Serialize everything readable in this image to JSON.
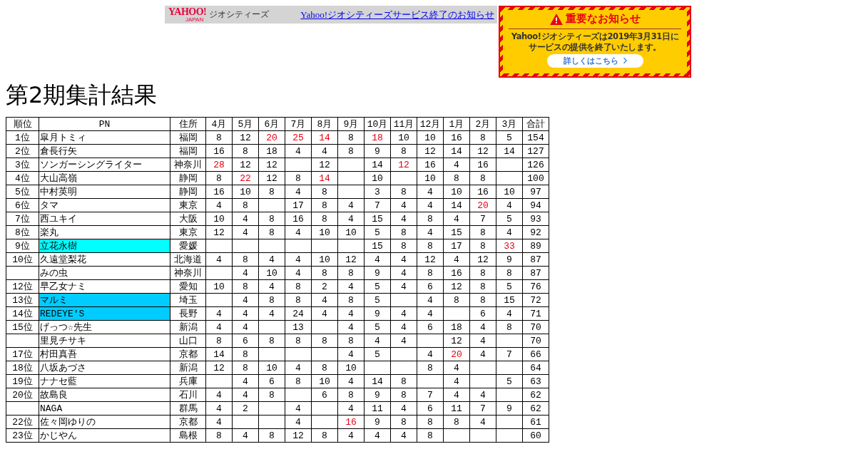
{
  "banner": {
    "logo": "YAHOO!",
    "logo_sub": "JAPAN",
    "service": "ジオシティーズ",
    "link": "Yahoo!ジオシティーズサービス終了のお知らせ"
  },
  "notice": {
    "heading": "重要なお知らせ",
    "lines": [
      "Yahoo!ジオシティーズは**2019年3月31日**に",
      "サービスの提供を終了いたします。"
    ],
    "button": "詳しくはこちら"
  },
  "title": "第2期集計結果",
  "table": {
    "columns": [
      "順位",
      "PN",
      "住所",
      "4月",
      "5月",
      "6月",
      "7月",
      "8月",
      "9月",
      "10月",
      "11月",
      "12月",
      "1月",
      "2月",
      "3月",
      "合計"
    ],
    "rows": [
      {
        "rank": "1位",
        "pn": "皐月トミィ",
        "pref": "福岡",
        "months": [
          {
            "value": "8",
            "highlight": false
          },
          {
            "value": "12",
            "highlight": false
          },
          {
            "value": "20",
            "highlight": true
          },
          {
            "value": "25",
            "highlight": true
          },
          {
            "value": "14",
            "highlight": true
          },
          {
            "value": "8",
            "highlight": false
          },
          {
            "value": "18",
            "highlight": true
          },
          {
            "value": "10",
            "highlight": false
          },
          {
            "value": "10",
            "highlight": false
          },
          {
            "value": "16",
            "highlight": false
          },
          {
            "value": "8",
            "highlight": false
          },
          {
            "value": "5",
            "highlight": false
          }
        ],
        "total": "154"
      },
      {
        "rank": "2位",
        "pn": "倉長行矢",
        "pref": "福岡",
        "months": [
          {
            "value": "16",
            "highlight": false
          },
          {
            "value": "8",
            "highlight": false
          },
          {
            "value": "18",
            "highlight": false
          },
          {
            "value": "4",
            "highlight": false
          },
          {
            "value": "4",
            "highlight": false
          },
          {
            "value": "8",
            "highlight": false
          },
          {
            "value": "9",
            "highlight": false
          },
          {
            "value": "8",
            "highlight": false
          },
          {
            "value": "12",
            "highlight": false
          },
          {
            "value": "14",
            "highlight": false
          },
          {
            "value": "12",
            "highlight": false
          },
          {
            "value": "14",
            "highlight": false
          }
        ],
        "total": "127"
      },
      {
        "rank": "3位",
        "pn": "ソンガーシングライター",
        "pref": "神奈川",
        "months": [
          {
            "value": "28",
            "highlight": true
          },
          {
            "value": "12",
            "highlight": false
          },
          {
            "value": "12",
            "highlight": false
          },
          {
            "blank": true
          },
          {
            "value": "12",
            "highlight": false
          },
          {
            "blank": true
          },
          {
            "value": "14",
            "highlight": false
          },
          {
            "value": "12",
            "highlight": true
          },
          {
            "value": "16",
            "highlight": false
          },
          {
            "value": "4",
            "highlight": false
          },
          {
            "value": "16",
            "highlight": false
          },
          {
            "blank": true
          }
        ],
        "total": "126"
      },
      {
        "rank": "4位",
        "pn": "大山高嶺",
        "pref": "静岡",
        "months": [
          {
            "value": "8",
            "highlight": false
          },
          {
            "value": "22",
            "highlight": true
          },
          {
            "value": "12",
            "highlight": false
          },
          {
            "value": "8",
            "highlight": false
          },
          {
            "value": "14",
            "highlight": true
          },
          {
            "blank": true
          },
          {
            "value": "10",
            "highlight": false
          },
          {
            "blank": true
          },
          {
            "value": "10",
            "highlight": false
          },
          {
            "value": "8",
            "highlight": false
          },
          {
            "value": "8",
            "highlight": false
          },
          {
            "blank": true
          }
        ],
        "total": "100"
      },
      {
        "rank": "5位",
        "pn": "中村英明",
        "pref": "静岡",
        "months": [
          {
            "value": "16",
            "highlight": false
          },
          {
            "value": "10",
            "highlight": false
          },
          {
            "value": "8",
            "highlight": false
          },
          {
            "value": "4",
            "highlight": false
          },
          {
            "value": "8",
            "highlight": false
          },
          {
            "blank": true
          },
          {
            "value": "3",
            "highlight": false
          },
          {
            "value": "8",
            "highlight": false
          },
          {
            "value": "4",
            "highlight": false
          },
          {
            "value": "10",
            "highlight": false
          },
          {
            "value": "16",
            "highlight": false
          },
          {
            "value": "10",
            "highlight": false
          }
        ],
        "total": "97"
      },
      {
        "rank": "6位",
        "pn": "タマ",
        "pref": "東京",
        "months": [
          {
            "value": "4",
            "highlight": false
          },
          {
            "value": "8",
            "highlight": false
          },
          {
            "blank": true
          },
          {
            "value": "17",
            "highlight": false
          },
          {
            "value": "8",
            "highlight": false
          },
          {
            "value": "4",
            "highlight": false
          },
          {
            "value": "7",
            "highlight": false
          },
          {
            "value": "4",
            "highlight": false
          },
          {
            "value": "4",
            "highlight": false
          },
          {
            "value": "14",
            "highlight": false
          },
          {
            "value": "20",
            "highlight": true
          },
          {
            "value": "4",
            "highlight": false
          }
        ],
        "total": "94"
      },
      {
        "rank": "7位",
        "pn": "西ユキイ",
        "pref": "大阪",
        "months": [
          {
            "value": "10",
            "highlight": false
          },
          {
            "value": "4",
            "highlight": false
          },
          {
            "value": "8",
            "highlight": false
          },
          {
            "value": "16",
            "highlight": false
          },
          {
            "value": "8",
            "highlight": false
          },
          {
            "value": "4",
            "highlight": false
          },
          {
            "value": "15",
            "highlight": false
          },
          {
            "value": "4",
            "highlight": false
          },
          {
            "value": "8",
            "highlight": false
          },
          {
            "value": "4",
            "highlight": false
          },
          {
            "value": "7",
            "highlight": false
          },
          {
            "value": "5",
            "highlight": false
          }
        ],
        "total": "93"
      },
      {
        "rank": "8位",
        "pn": "楽丸",
        "pref": "東京",
        "months": [
          {
            "value": "12",
            "highlight": false
          },
          {
            "value": "4",
            "highlight": false
          },
          {
            "value": "8",
            "highlight": false
          },
          {
            "value": "4",
            "highlight": false
          },
          {
            "value": "10",
            "highlight": false
          },
          {
            "value": "10",
            "highlight": false
          },
          {
            "value": "5",
            "highlight": false
          },
          {
            "value": "8",
            "highlight": false
          },
          {
            "value": "4",
            "highlight": false
          },
          {
            "value": "15",
            "highlight": false
          },
          {
            "value": "8",
            "highlight": false
          },
          {
            "value": "4",
            "highlight": false
          }
        ],
        "total": "92"
      },
      {
        "rank": "9位",
        "pn": "立花永樹",
        "color": "#00ffff",
        "pref": "愛媛",
        "months": [
          {
            "blank": true
          },
          {
            "blank": true
          },
          {
            "blank": true
          },
          {
            "blank": true
          },
          {
            "blank": true
          },
          {
            "blank": true
          },
          {
            "value": "15",
            "highlight": false
          },
          {
            "value": "8",
            "highlight": false
          },
          {
            "value": "8",
            "highlight": false
          },
          {
            "value": "17",
            "highlight": false
          },
          {
            "value": "8",
            "highlight": false
          },
          {
            "value": "33",
            "highlight": true
          }
        ],
        "total": "89"
      },
      {
        "rank": "10位",
        "pn": "久遠堂梨花",
        "pref": "北海道",
        "months": [
          {
            "value": "4",
            "highlight": false
          },
          {
            "value": "8",
            "highlight": false
          },
          {
            "value": "4",
            "highlight": false
          },
          {
            "value": "4",
            "highlight": false
          },
          {
            "value": "10",
            "highlight": false
          },
          {
            "value": "12",
            "highlight": false
          },
          {
            "value": "4",
            "highlight": false
          },
          {
            "value": "4",
            "highlight": false
          },
          {
            "value": "12",
            "highlight": false
          },
          {
            "value": "4",
            "highlight": false
          },
          {
            "value": "12",
            "highlight": false
          },
          {
            "value": "9",
            "highlight": false
          }
        ],
        "total": "87"
      },
      {
        "pn": "みの虫",
        "pref": "神奈川",
        "months": [
          {
            "blank": true
          },
          {
            "value": "4",
            "highlight": false
          },
          {
            "value": "10",
            "highlight": false
          },
          {
            "value": "4",
            "highlight": false
          },
          {
            "value": "8",
            "highlight": false
          },
          {
            "value": "8",
            "highlight": false
          },
          {
            "value": "9",
            "highlight": false
          },
          {
            "value": "4",
            "highlight": false
          },
          {
            "value": "8",
            "highlight": false
          },
          {
            "value": "16",
            "highlight": false
          },
          {
            "value": "8",
            "highlight": false
          },
          {
            "value": "8",
            "highlight": false
          }
        ],
        "total": "87"
      },
      {
        "rank": "12位",
        "pn": "早乙女ナミ",
        "pref": "愛知",
        "months": [
          {
            "value": "10",
            "highlight": false
          },
          {
            "value": "8",
            "highlight": false
          },
          {
            "value": "4",
            "highlight": false
          },
          {
            "value": "8",
            "highlight": false
          },
          {
            "value": "2",
            "highlight": false
          },
          {
            "value": "4",
            "highlight": false
          },
          {
            "value": "5",
            "highlight": false
          },
          {
            "value": "4",
            "highlight": false
          },
          {
            "value": "6",
            "highlight": false
          },
          {
            "value": "12",
            "highlight": false
          },
          {
            "value": "8",
            "highlight": false
          },
          {
            "value": "5",
            "highlight": false
          }
        ],
        "total": "76"
      },
      {
        "rank": "13位",
        "pn": "マルミ",
        "color": "#00ccff",
        "pref": "埼玉",
        "months": [
          {
            "blank": true
          },
          {
            "value": "4",
            "highlight": false
          },
          {
            "value": "8",
            "highlight": false
          },
          {
            "value": "8",
            "highlight": false
          },
          {
            "value": "4",
            "highlight": false
          },
          {
            "value": "8",
            "highlight": false
          },
          {
            "value": "5",
            "highlight": false
          },
          {
            "blank": true
          },
          {
            "value": "4",
            "highlight": false
          },
          {
            "value": "8",
            "highlight": false
          },
          {
            "value": "8",
            "highlight": false
          },
          {
            "value": "15",
            "highlight": false
          }
        ],
        "total": "72"
      },
      {
        "rank": "14位",
        "pn": "REDEYE'S",
        "color": "#00ccff",
        "pref": "長野",
        "months": [
          {
            "value": "4",
            "highlight": false
          },
          {
            "value": "4",
            "highlight": false
          },
          {
            "value": "4",
            "highlight": false
          },
          {
            "value": "24",
            "highlight": false
          },
          {
            "value": "4",
            "highlight": false
          },
          {
            "value": "4",
            "highlight": false
          },
          {
            "value": "9",
            "highlight": false
          },
          {
            "value": "4",
            "highlight": false
          },
          {
            "value": "4",
            "highlight": false
          },
          {
            "blank": true
          },
          {
            "value": "6",
            "highlight": false
          },
          {
            "value": "4",
            "highlight": false
          }
        ],
        "total": "71"
      },
      {
        "rank": "15位",
        "pn": "げっつ☆先生",
        "pref": "新潟",
        "months": [
          {
            "value": "4",
            "highlight": false
          },
          {
            "value": "4",
            "highlight": false
          },
          {
            "blank": true
          },
          {
            "value": "13",
            "highlight": false
          },
          {
            "blank": true
          },
          {
            "value": "4",
            "highlight": false
          },
          {
            "value": "5",
            "highlight": false
          },
          {
            "value": "4",
            "highlight": false
          },
          {
            "value": "6",
            "highlight": false
          },
          {
            "value": "18",
            "highlight": false
          },
          {
            "value": "4",
            "highlight": false
          },
          {
            "value": "8",
            "highlight": false
          }
        ],
        "total": "70"
      },
      {
        "pn": "里見チサキ",
        "pref": "山口",
        "months": [
          {
            "value": "8",
            "highlight": false
          },
          {
            "value": "6",
            "highlight": false
          },
          {
            "value": "8",
            "highlight": false
          },
          {
            "value": "8",
            "highlight": false
          },
          {
            "value": "8",
            "highlight": false
          },
          {
            "value": "8",
            "highlight": false
          },
          {
            "value": "4",
            "highlight": false
          },
          {
            "value": "4",
            "highlight": false
          },
          {
            "blank": true
          },
          {
            "value": "12",
            "highlight": false
          },
          {
            "value": "4",
            "highlight": false
          },
          {
            "blank": true
          }
        ],
        "total": "70"
      },
      {
        "rank": "17位",
        "pn": "村田真吾",
        "pref": "京都",
        "months": [
          {
            "value": "14",
            "highlight": false
          },
          {
            "value": "8",
            "highlight": false
          },
          {
            "blank": true
          },
          {
            "blank": true
          },
          {
            "blank": true
          },
          {
            "value": "4",
            "highlight": false
          },
          {
            "value": "5",
            "highlight": false
          },
          {
            "blank": true
          },
          {
            "value": "4",
            "highlight": false
          },
          {
            "value": "20",
            "highlight": true
          },
          {
            "value": "4",
            "highlight": false
          },
          {
            "value": "7",
            "highlight": false
          }
        ],
        "total": "66"
      },
      {
        "rank": "18位",
        "pn": "八坂あづさ",
        "pref": "新潟",
        "months": [
          {
            "value": "12",
            "highlight": false
          },
          {
            "value": "8",
            "highlight": false
          },
          {
            "value": "10",
            "highlight": false
          },
          {
            "value": "4",
            "highlight": false
          },
          {
            "value": "8",
            "highlight": false
          },
          {
            "value": "10",
            "highlight": false
          },
          {
            "blank": true
          },
          {
            "blank": true
          },
          {
            "value": "8",
            "highlight": false
          },
          {
            "value": "4",
            "highlight": false
          },
          {
            "blank": true
          },
          {
            "blank": true
          }
        ],
        "total": "64"
      },
      {
        "rank": "19位",
        "pn": "ナナセ藍",
        "pref": "兵庫",
        "months": [
          {
            "blank": true
          },
          {
            "value": "4",
            "highlight": false
          },
          {
            "value": "6",
            "highlight": false
          },
          {
            "value": "8",
            "highlight": false
          },
          {
            "value": "10",
            "highlight": false
          },
          {
            "value": "4",
            "highlight": false
          },
          {
            "value": "14",
            "highlight": false
          },
          {
            "value": "8",
            "highlight": false
          },
          {
            "blank": true
          },
          {
            "value": "4",
            "highlight": false
          },
          {
            "blank": true
          },
          {
            "value": "5",
            "highlight": false
          }
        ],
        "total": "63"
      },
      {
        "rank": "20位",
        "pn": "故島良",
        "pref": "石川",
        "months": [
          {
            "value": "4",
            "highlight": false
          },
          {
            "value": "4",
            "highlight": false
          },
          {
            "value": "8",
            "highlight": false
          },
          {
            "blank": true
          },
          {
            "value": "6",
            "highlight": false
          },
          {
            "value": "8",
            "highlight": false
          },
          {
            "value": "9",
            "highlight": false
          },
          {
            "value": "8",
            "highlight": false
          },
          {
            "value": "7",
            "highlight": false
          },
          {
            "value": "4",
            "highlight": false
          },
          {
            "value": "4",
            "highlight": false
          },
          {
            "blank": true
          }
        ],
        "total": "62"
      },
      {
        "pn": "NAGA",
        "pref": "群馬",
        "months": [
          {
            "value": "4",
            "highlight": false
          },
          {
            "value": "2",
            "highlight": false
          },
          {
            "blank": true
          },
          {
            "value": "4",
            "highlight": false
          },
          {
            "blank": true
          },
          {
            "value": "4",
            "highlight": false
          },
          {
            "value": "11",
            "highlight": false
          },
          {
            "value": "4",
            "highlight": false
          },
          {
            "value": "6",
            "highlight": false
          },
          {
            "value": "11",
            "highlight": false
          },
          {
            "value": "7",
            "highlight": false
          },
          {
            "value": "9",
            "highlight": false
          }
        ],
        "total": "62"
      },
      {
        "rank": "22位",
        "pn": "佐々岡ゆりの",
        "pref": "京都",
        "months": [
          {
            "value": "4",
            "highlight": false
          },
          {
            "blank": true
          },
          {
            "blank": true
          },
          {
            "value": "4",
            "highlight": false
          },
          {
            "blank": true
          },
          {
            "value": "16",
            "highlight": true
          },
          {
            "value": "9",
            "highlight": false
          },
          {
            "value": "8",
            "highlight": false
          },
          {
            "value": "8",
            "highlight": false
          },
          {
            "value": "8",
            "highlight": false
          },
          {
            "value": "4",
            "highlight": false
          },
          {
            "blank": true
          }
        ],
        "total": "61"
      },
      {
        "rank": "23位",
        "pn": "かじやん",
        "pref": "島根",
        "months": [
          {
            "value": "8",
            "highlight": false
          },
          {
            "value": "4",
            "highlight": false
          },
          {
            "value": "8",
            "highlight": false
          },
          {
            "value": "12",
            "highlight": false
          },
          {
            "value": "8",
            "highlight": false
          },
          {
            "value": "4",
            "highlight": false
          },
          {
            "value": "4",
            "highlight": false
          },
          {
            "value": "4",
            "highlight": false
          },
          {
            "value": "8",
            "highlight": false
          },
          {
            "blank": true
          },
          {
            "blank": true
          },
          {
            "blank": true
          }
        ],
        "total": "60"
      }
    ]
  }
}
